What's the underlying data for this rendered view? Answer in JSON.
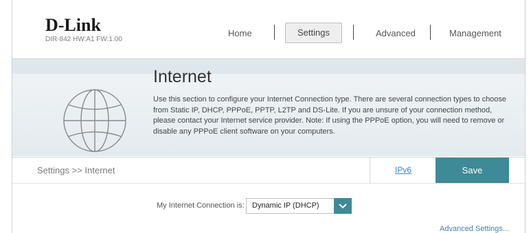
{
  "header": {
    "logo": "D-Link",
    "device_info": "DIR-842  HW:A1  FW:1.00",
    "nav": {
      "home": "Home",
      "settings": "Settings",
      "advanced": "Advanced",
      "management": "Management"
    }
  },
  "hero": {
    "title": "Internet",
    "description": "Use this section to configure your Internet Connection type. There are several connection types to choose from Static IP, DHCP, PPPoE, PPTP, L2TP and DS-Lite. If you are unsure of your connection method, please contact your Internet service provider. Note: If using the PPPoE option, you will need to remove or disable any PPPoE client software on your computers.",
    "icon": "globe-icon"
  },
  "toolbar": {
    "breadcrumb": "Settings >> Internet",
    "ipv6_link": "IPv6",
    "save_label": "Save"
  },
  "form": {
    "connection_label": "My Internet Connection is:",
    "connection_value": "Dynamic IP (DHCP)",
    "advanced_link": "Advanced Settings..."
  },
  "colors": {
    "accent": "#3e8a96",
    "link": "#3f7fb6",
    "hero_bg": "#e8eef2"
  }
}
